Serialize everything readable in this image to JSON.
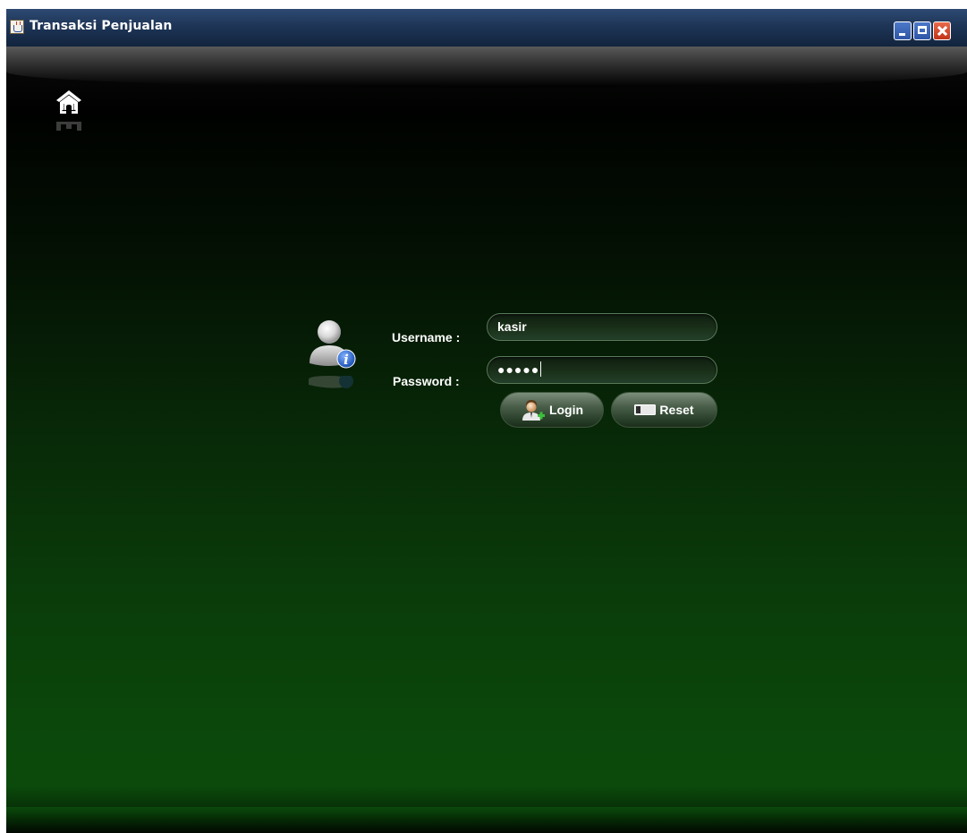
{
  "window": {
    "title": "Transaksi Penjualan",
    "controls": [
      "minimize",
      "maximize",
      "close"
    ]
  },
  "toolbar": {
    "home_icon": "home-icon"
  },
  "login_form": {
    "avatar_icon": "user-info-icon",
    "username_label": "Username :",
    "username_value": "kasir",
    "password_label": "Password :",
    "password_masked": "●●●●●",
    "login_button": "Login",
    "login_icon": "add-user-icon",
    "reset_button": "Reset",
    "reset_icon": "eraser-icon"
  },
  "colors": {
    "titlebar": "#1e3557",
    "background_top": "#000100",
    "background_bottom": "#0b480b",
    "close_button": "#c1331a"
  }
}
